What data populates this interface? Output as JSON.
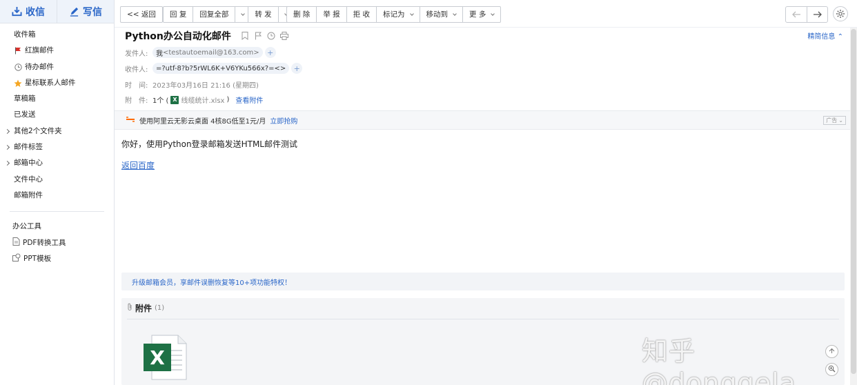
{
  "sidebar": {
    "receive_label": "收信",
    "compose_label": "写信",
    "folders": [
      {
        "label": "收件箱"
      },
      {
        "label": "红旗邮件"
      },
      {
        "label": "待办邮件"
      },
      {
        "label": "星标联系人邮件"
      },
      {
        "label": "草稿箱"
      },
      {
        "label": "已发送"
      },
      {
        "label": "其他2个文件夹"
      },
      {
        "label": "邮件标签"
      },
      {
        "label": "邮箱中心"
      },
      {
        "label": "文件中心"
      },
      {
        "label": "邮箱附件"
      }
    ],
    "tools_title": "办公工具",
    "tools": [
      {
        "label": "PDF转换工具"
      },
      {
        "label": "PPT模板"
      }
    ]
  },
  "toolbar": {
    "back": "<< 返回",
    "reply": "回 复",
    "reply_all": "回复全部",
    "forward": "转 发",
    "delete": "删 除",
    "report": "举 报",
    "reject": "拒 收",
    "mark_as": "标记为",
    "move_to": "移动到",
    "more": "更 多"
  },
  "mail": {
    "subject": "Python办公自动化邮件",
    "simple_info": "精简信息",
    "sender_label": "发件人:",
    "sender_name": "我",
    "sender_email": "<testautoemail@163.com>",
    "recipient_label": "收件人:",
    "recipient": "=?utf-8?b?5rWL6K+V6YKu566x?=<>",
    "time_label": "时　间:",
    "time": "2023年03月16日 21:16 (星期四)",
    "attachment_label": "附　件:",
    "attachment_count": "1个 (",
    "attachment_name": "线缆统计.xlsx",
    "attachment_close": ")",
    "view_attachment": "查看附件",
    "body_text": "你好，使用Python登录邮箱发送HTML邮件测试",
    "body_link": "返回百度"
  },
  "ad": {
    "text": "使用阿里云无影云桌面 4核8G低至1元/月",
    "link": "立即抢购",
    "tag": "广告"
  },
  "promo": {
    "text": "升级邮箱会员，享邮件误删恢复等10+项功能特权！"
  },
  "attachments": {
    "title": "附件",
    "count": "(1)"
  },
  "watermark": "知乎 @donggela",
  "colors": {
    "accent": "#2a66c8",
    "excel_green": "#1e7145",
    "flag_red": "#d9312b",
    "star": "#f5a623"
  }
}
